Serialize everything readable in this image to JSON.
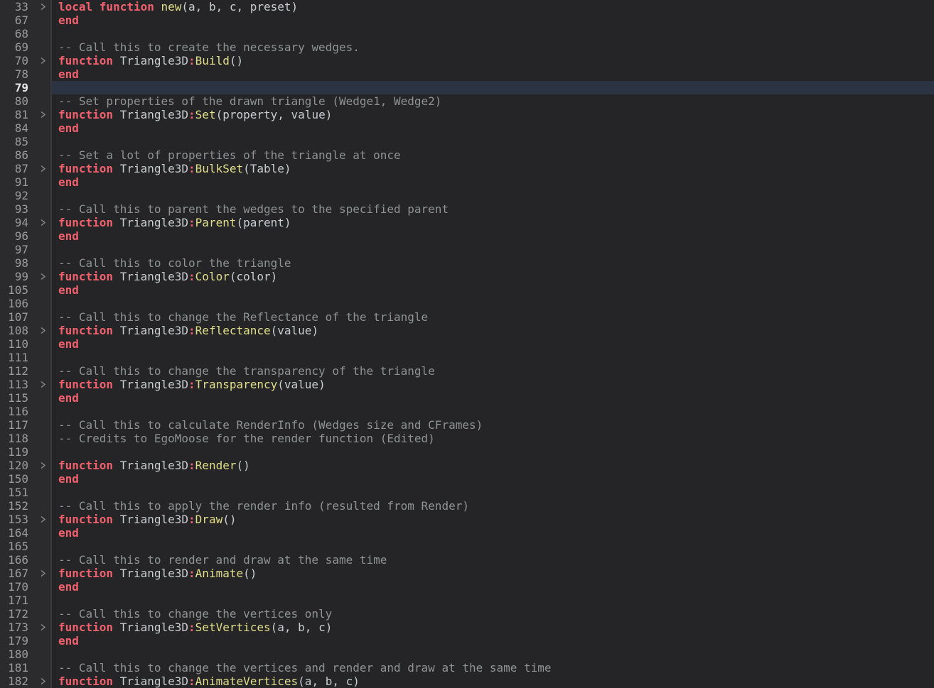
{
  "editor": {
    "type": "code-editor",
    "language": "lua",
    "active_line": "79",
    "colors": {
      "background": "#252528",
      "gutter_background": "#2b2b2d",
      "divider": "#39393c",
      "current_line_highlight": "#2c3343",
      "line_number": "#9b9b9b",
      "line_number_active": "#e9e9e9",
      "keyword": "#f2606c",
      "function_name": "#e2df8a",
      "plain_text": "#c9cdd0",
      "comment": "#909294",
      "fold_icon": "#8a8a8a"
    },
    "icons": {
      "fold_collapsed": "chevron-right-icon"
    },
    "lines": [
      {
        "n": "33",
        "fold": true,
        "active": false,
        "tokens": [
          [
            "kw",
            "local function"
          ],
          [
            "tx",
            " "
          ],
          [
            "fn",
            "new"
          ],
          [
            "tx",
            "(a, b, c, preset)"
          ]
        ]
      },
      {
        "n": "67",
        "fold": false,
        "active": false,
        "tokens": [
          [
            "kw",
            "end"
          ]
        ]
      },
      {
        "n": "68",
        "fold": false,
        "active": false,
        "tokens": []
      },
      {
        "n": "69",
        "fold": false,
        "active": false,
        "tokens": [
          [
            "cm",
            "-- Call this to create the necessary wedges."
          ]
        ]
      },
      {
        "n": "70",
        "fold": true,
        "active": false,
        "tokens": [
          [
            "kw",
            "function"
          ],
          [
            "tx",
            " Triangle3D"
          ],
          [
            "kw",
            ":"
          ],
          [
            "fn",
            "Build"
          ],
          [
            "tx",
            "()"
          ]
        ]
      },
      {
        "n": "78",
        "fold": false,
        "active": false,
        "tokens": [
          [
            "kw",
            "end"
          ]
        ]
      },
      {
        "n": "79",
        "fold": false,
        "active": true,
        "tokens": []
      },
      {
        "n": "80",
        "fold": false,
        "active": false,
        "tokens": [
          [
            "cm",
            "-- Set properties of the drawn triangle (Wedge1, Wedge2)"
          ]
        ]
      },
      {
        "n": "81",
        "fold": true,
        "active": false,
        "tokens": [
          [
            "kw",
            "function"
          ],
          [
            "tx",
            " Triangle3D"
          ],
          [
            "kw",
            ":"
          ],
          [
            "fn",
            "Set"
          ],
          [
            "tx",
            "(property, value)"
          ]
        ]
      },
      {
        "n": "84",
        "fold": false,
        "active": false,
        "tokens": [
          [
            "kw",
            "end"
          ]
        ]
      },
      {
        "n": "85",
        "fold": false,
        "active": false,
        "tokens": []
      },
      {
        "n": "86",
        "fold": false,
        "active": false,
        "tokens": [
          [
            "cm",
            "-- Set a lot of properties of the triangle at once"
          ]
        ]
      },
      {
        "n": "87",
        "fold": true,
        "active": false,
        "tokens": [
          [
            "kw",
            "function"
          ],
          [
            "tx",
            " Triangle3D"
          ],
          [
            "kw",
            ":"
          ],
          [
            "fn",
            "BulkSet"
          ],
          [
            "tx",
            "(Table)"
          ]
        ]
      },
      {
        "n": "91",
        "fold": false,
        "active": false,
        "tokens": [
          [
            "kw",
            "end"
          ]
        ]
      },
      {
        "n": "92",
        "fold": false,
        "active": false,
        "tokens": []
      },
      {
        "n": "93",
        "fold": false,
        "active": false,
        "tokens": [
          [
            "cm",
            "-- Call this to parent the wedges to the specified parent"
          ]
        ]
      },
      {
        "n": "94",
        "fold": true,
        "active": false,
        "tokens": [
          [
            "kw",
            "function"
          ],
          [
            "tx",
            " Triangle3D"
          ],
          [
            "kw",
            ":"
          ],
          [
            "fn",
            "Parent"
          ],
          [
            "tx",
            "(parent)"
          ]
        ]
      },
      {
        "n": "96",
        "fold": false,
        "active": false,
        "tokens": [
          [
            "kw",
            "end"
          ]
        ]
      },
      {
        "n": "97",
        "fold": false,
        "active": false,
        "tokens": []
      },
      {
        "n": "98",
        "fold": false,
        "active": false,
        "tokens": [
          [
            "cm",
            "-- Call this to color the triangle"
          ]
        ]
      },
      {
        "n": "99",
        "fold": true,
        "active": false,
        "tokens": [
          [
            "kw",
            "function"
          ],
          [
            "tx",
            " Triangle3D"
          ],
          [
            "kw",
            ":"
          ],
          [
            "fn",
            "Color"
          ],
          [
            "tx",
            "(color)"
          ]
        ]
      },
      {
        "n": "105",
        "fold": false,
        "active": false,
        "tokens": [
          [
            "kw",
            "end"
          ]
        ]
      },
      {
        "n": "106",
        "fold": false,
        "active": false,
        "tokens": []
      },
      {
        "n": "107",
        "fold": false,
        "active": false,
        "tokens": [
          [
            "cm",
            "-- Call this to change the Reflectance of the triangle"
          ]
        ]
      },
      {
        "n": "108",
        "fold": true,
        "active": false,
        "tokens": [
          [
            "kw",
            "function"
          ],
          [
            "tx",
            " Triangle3D"
          ],
          [
            "kw",
            ":"
          ],
          [
            "fn",
            "Reflectance"
          ],
          [
            "tx",
            "(value)"
          ]
        ]
      },
      {
        "n": "110",
        "fold": false,
        "active": false,
        "tokens": [
          [
            "kw",
            "end"
          ]
        ]
      },
      {
        "n": "111",
        "fold": false,
        "active": false,
        "tokens": []
      },
      {
        "n": "112",
        "fold": false,
        "active": false,
        "tokens": [
          [
            "cm",
            "-- Call this to change the transparency of the triangle"
          ]
        ]
      },
      {
        "n": "113",
        "fold": true,
        "active": false,
        "tokens": [
          [
            "kw",
            "function"
          ],
          [
            "tx",
            " Triangle3D"
          ],
          [
            "kw",
            ":"
          ],
          [
            "fn",
            "Transparency"
          ],
          [
            "tx",
            "(value)"
          ]
        ]
      },
      {
        "n": "115",
        "fold": false,
        "active": false,
        "tokens": [
          [
            "kw",
            "end"
          ]
        ]
      },
      {
        "n": "116",
        "fold": false,
        "active": false,
        "tokens": []
      },
      {
        "n": "117",
        "fold": false,
        "active": false,
        "tokens": [
          [
            "cm",
            "-- Call this to calculate RenderInfo (Wedges size and CFrames)"
          ]
        ]
      },
      {
        "n": "118",
        "fold": false,
        "active": false,
        "tokens": [
          [
            "cm",
            "-- Credits to EgoMoose for the render function (Edited)"
          ]
        ]
      },
      {
        "n": "119",
        "fold": false,
        "active": false,
        "tokens": []
      },
      {
        "n": "120",
        "fold": true,
        "active": false,
        "tokens": [
          [
            "kw",
            "function"
          ],
          [
            "tx",
            " Triangle3D"
          ],
          [
            "kw",
            ":"
          ],
          [
            "fn",
            "Render"
          ],
          [
            "tx",
            "()"
          ]
        ]
      },
      {
        "n": "150",
        "fold": false,
        "active": false,
        "tokens": [
          [
            "kw",
            "end"
          ]
        ]
      },
      {
        "n": "151",
        "fold": false,
        "active": false,
        "tokens": []
      },
      {
        "n": "152",
        "fold": false,
        "active": false,
        "tokens": [
          [
            "cm",
            "-- Call this to apply the render info (resulted from Render)"
          ]
        ]
      },
      {
        "n": "153",
        "fold": true,
        "active": false,
        "tokens": [
          [
            "kw",
            "function"
          ],
          [
            "tx",
            " Triangle3D"
          ],
          [
            "kw",
            ":"
          ],
          [
            "fn",
            "Draw"
          ],
          [
            "tx",
            "()"
          ]
        ]
      },
      {
        "n": "164",
        "fold": false,
        "active": false,
        "tokens": [
          [
            "kw",
            "end"
          ]
        ]
      },
      {
        "n": "165",
        "fold": false,
        "active": false,
        "tokens": []
      },
      {
        "n": "166",
        "fold": false,
        "active": false,
        "tokens": [
          [
            "cm",
            "-- Call this to render and draw at the same time"
          ]
        ]
      },
      {
        "n": "167",
        "fold": true,
        "active": false,
        "tokens": [
          [
            "kw",
            "function"
          ],
          [
            "tx",
            " Triangle3D"
          ],
          [
            "kw",
            ":"
          ],
          [
            "fn",
            "Animate"
          ],
          [
            "tx",
            "()"
          ]
        ]
      },
      {
        "n": "170",
        "fold": false,
        "active": false,
        "tokens": [
          [
            "kw",
            "end"
          ]
        ]
      },
      {
        "n": "171",
        "fold": false,
        "active": false,
        "tokens": []
      },
      {
        "n": "172",
        "fold": false,
        "active": false,
        "tokens": [
          [
            "cm",
            "-- Call this to change the vertices only"
          ]
        ]
      },
      {
        "n": "173",
        "fold": true,
        "active": false,
        "tokens": [
          [
            "kw",
            "function"
          ],
          [
            "tx",
            " Triangle3D"
          ],
          [
            "kw",
            ":"
          ],
          [
            "fn",
            "SetVertices"
          ],
          [
            "tx",
            "(a, b, c)"
          ]
        ]
      },
      {
        "n": "179",
        "fold": false,
        "active": false,
        "tokens": [
          [
            "kw",
            "end"
          ]
        ]
      },
      {
        "n": "180",
        "fold": false,
        "active": false,
        "tokens": []
      },
      {
        "n": "181",
        "fold": false,
        "active": false,
        "tokens": [
          [
            "cm",
            "-- Call this to change the vertices and render and draw at the same time"
          ]
        ]
      },
      {
        "n": "182",
        "fold": true,
        "active": false,
        "tokens": [
          [
            "kw",
            "function"
          ],
          [
            "tx",
            " Triangle3D"
          ],
          [
            "kw",
            ":"
          ],
          [
            "fn",
            "AnimateVertices"
          ],
          [
            "tx",
            "(a, b, c)"
          ]
        ]
      }
    ]
  }
}
